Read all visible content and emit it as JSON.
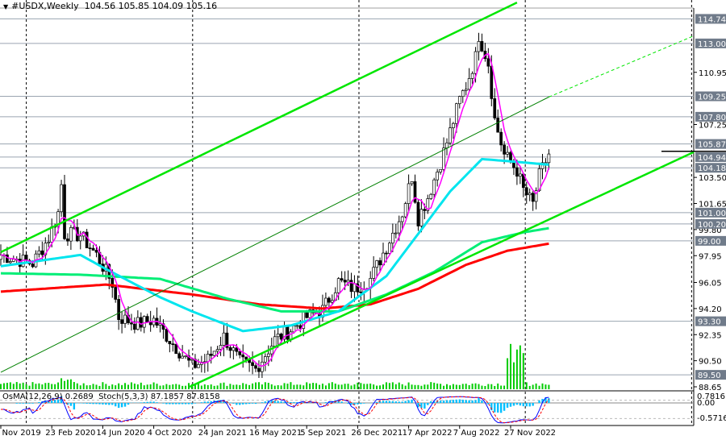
{
  "header": {
    "symbol": "#USDX,Weekly",
    "open": "104.56",
    "high": "105.85",
    "low": "104.09",
    "close": "105.16"
  },
  "indicator_label": {
    "osma": "OsMA(12,26,9) 0.2689",
    "stoch": "Stoch(5,3,3) 87.1857 87.8158"
  },
  "indicator_axis": [
    "0.7816",
    "0.00",
    "-0.5716"
  ],
  "colors": {
    "up_channel": "#00e600",
    "ma_fast": "#ff00ff",
    "ma_50": "#00e5ee",
    "ma_100": "#00ee76",
    "ma_200": "#ff0000",
    "volume": "#00cc00",
    "osma": "#00bfff",
    "stoch_main": "#0000ff",
    "stoch_signal": "#ff0000",
    "level_box": "#707b8a"
  },
  "chart_data": {
    "type": "candlestick",
    "title": "#USDX,Weekly",
    "ylim": [
      88.65,
      114.74
    ],
    "price_ticks": [
      "110.95",
      "107.25",
      "103.50",
      "101.65",
      "99.80",
      "97.95",
      "96.05",
      "94.20",
      "92.35",
      "90.50",
      "88.65"
    ],
    "levels": [
      "114.74",
      "113.00",
      "109.25",
      "107.80",
      "105.87",
      "104.94",
      "104.18",
      "101.00",
      "100.20",
      "99.00",
      "93.30",
      "89.50"
    ],
    "x_labels": [
      {
        "week": 0,
        "label": "3 Nov 2019"
      },
      {
        "week": 16,
        "label": "23 Feb 2020"
      },
      {
        "week": 32,
        "label": "14 Jun 2020"
      },
      {
        "week": 48,
        "label": "4 Oct 2020"
      },
      {
        "week": 64,
        "label": "24 Jan 2021"
      },
      {
        "week": 80,
        "label": "16 May 2021"
      },
      {
        "week": 96,
        "label": "5 Sep 2021"
      },
      {
        "week": 112,
        "label": "26 Dec 2021"
      },
      {
        "week": 128,
        "label": "17 Apr 2022"
      },
      {
        "week": 144,
        "label": "7 Aug 2022"
      },
      {
        "week": 160,
        "label": "27 Nov 2022"
      }
    ],
    "year_separators_weeks": [
      8,
      60.2,
      112.4,
      164.6,
      216.8
    ],
    "close_path": [
      [
        0,
        98.0
      ],
      [
        10,
        97.4
      ],
      [
        15,
        99.2
      ],
      [
        18,
        101
      ],
      [
        19,
        103
      ],
      [
        20,
        99.5
      ],
      [
        25,
        99.4
      ],
      [
        30,
        98
      ],
      [
        35,
        96
      ],
      [
        37,
        93.6
      ],
      [
        43,
        93.1
      ],
      [
        48,
        93.4
      ],
      [
        53,
        92
      ],
      [
        60,
        90.1
      ],
      [
        65,
        90.6
      ],
      [
        70,
        92.2
      ],
      [
        75,
        90.4
      ],
      [
        80,
        89.9
      ],
      [
        86,
        92.0
      ],
      [
        91,
        92.7
      ],
      [
        96,
        93.6
      ],
      [
        101,
        94.1
      ],
      [
        106,
        96.1
      ],
      [
        111,
        95.6
      ],
      [
        116,
        96.3
      ],
      [
        121,
        98.6
      ],
      [
        126,
        101
      ],
      [
        129,
        103.6
      ],
      [
        131,
        100.6
      ],
      [
        134,
        102.1
      ],
      [
        138,
        104.6
      ],
      [
        140,
        106
      ],
      [
        144,
        109
      ],
      [
        146,
        110
      ],
      [
        149,
        112
      ],
      [
        150,
        113.6
      ],
      [
        153,
        111.6
      ],
      [
        155,
        107.6
      ],
      [
        158,
        105.1
      ],
      [
        162,
        104
      ],
      [
        164,
        102.6
      ],
      [
        167,
        101.6
      ],
      [
        169,
        103.6
      ],
      [
        172,
        105.16
      ]
    ],
    "ma_50": [
      [
        0,
        97.2
      ],
      [
        25,
        98
      ],
      [
        33,
        97
      ],
      [
        50,
        95
      ],
      [
        60,
        94
      ],
      [
        76,
        92.6
      ],
      [
        91,
        93
      ],
      [
        106,
        94
      ],
      [
        121,
        96.5
      ],
      [
        131,
        99.5
      ],
      [
        141,
        102.5
      ],
      [
        151,
        104.8
      ],
      [
        162,
        104.6
      ],
      [
        172,
        104.4
      ]
    ],
    "ma_100": [
      [
        0,
        96.7
      ],
      [
        25,
        96.6
      ],
      [
        50,
        96.3
      ],
      [
        71,
        94.9
      ],
      [
        88,
        94
      ],
      [
        106,
        94
      ],
      [
        121,
        95.2
      ],
      [
        136,
        96.8
      ],
      [
        151,
        98.9
      ],
      [
        164,
        99.6
      ],
      [
        172,
        99.9
      ]
    ],
    "ma_200": [
      [
        0,
        95.4
      ],
      [
        33,
        95.9
      ],
      [
        60,
        95.2
      ],
      [
        81,
        94.5
      ],
      [
        101,
        94.2
      ],
      [
        116,
        94.5
      ],
      [
        131,
        95.6
      ],
      [
        146,
        97.3
      ],
      [
        159,
        98.3
      ],
      [
        172,
        98.8
      ]
    ],
    "trendlines": [
      {
        "name": "channel-upper",
        "from": [
          0,
          98.2
        ],
        "to": [
          162,
          115.9
        ],
        "style": "thick"
      },
      {
        "name": "channel-lower",
        "from": [
          59.3,
          88.65
        ],
        "to": [
          227.6,
          106.36
        ],
        "style": "thick"
      },
      {
        "name": "channel-mid",
        "from": [
          0,
          89.68
        ],
        "to": [
          172,
          109.2
        ],
        "style": "thin"
      },
      {
        "name": "channel-mid-ext",
        "from": [
          172,
          109.2
        ],
        "to": [
          227.6,
          114.5
        ],
        "style": "dashed"
      }
    ]
  }
}
